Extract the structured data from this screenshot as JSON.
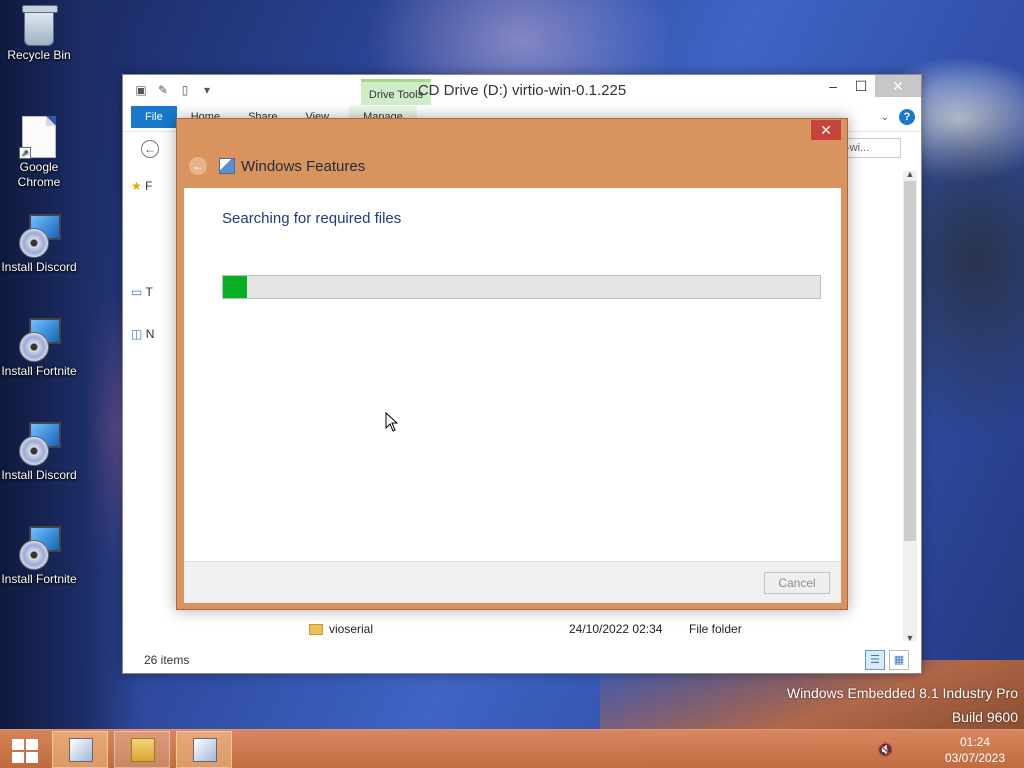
{
  "desktop": {
    "icons": [
      {
        "label": "Recycle Bin"
      },
      {
        "label": "Google Chrome"
      },
      {
        "label": "Install Discord"
      },
      {
        "label": "Install Fortnite"
      },
      {
        "label": "Install Discord"
      },
      {
        "label": "Install Fortnite"
      }
    ],
    "watermark_line1": "Windows Embedded 8.1 Industry Pro",
    "watermark_line2": "Build 9600"
  },
  "explorer": {
    "title": "CD Drive (D:) virtio-win-0.1.225",
    "contextual_tab_group": "Drive Tools",
    "tabs": [
      "File",
      "Home",
      "Share",
      "View",
      "Manage"
    ],
    "search_placeholder": "-wi...",
    "nav_items": [
      "F",
      "T",
      "N"
    ],
    "file_row": {
      "name": "vioserial",
      "date": "24/10/2022 02:34",
      "type": "File folder"
    },
    "status_items": "26 items"
  },
  "dialog": {
    "title": "Windows Features",
    "status": "Searching for required files",
    "progress_fraction": 0.04,
    "cancel_label": "Cancel",
    "close_glyph": "✕",
    "accent_color": "#d9935f",
    "progress_color": "#06b025"
  },
  "taskbar": {
    "time": "01:24",
    "date": "03/07/2023",
    "volume_icon": "volume-muted-icon"
  }
}
